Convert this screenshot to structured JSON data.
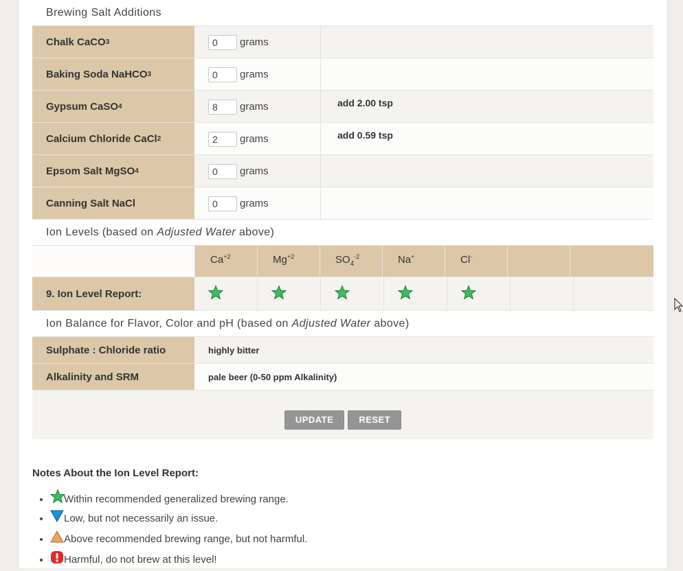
{
  "salts": {
    "title": "Brewing Salt Additions",
    "unit": "grams",
    "rows": [
      {
        "name": "Chalk CaCO",
        "sub": "3",
        "value": "0",
        "note": ""
      },
      {
        "name": "Baking Soda NaHCO",
        "sub": "3",
        "value": "0",
        "note": ""
      },
      {
        "name": "Gypsum CaSO",
        "sub": "4",
        "value": "8",
        "note": "add 2.00 tsp"
      },
      {
        "name": "Calcium Chloride CaCl",
        "sub": "2",
        "value": "2",
        "note": "add 0.59 tsp"
      },
      {
        "name": "Epsom Salt MgSO",
        "sub": "4",
        "value": "0",
        "note": ""
      },
      {
        "name": "Canning Salt NaCl",
        "sub": "",
        "value": "0",
        "note": ""
      }
    ]
  },
  "ions": {
    "title_pre": "Ion Levels (based on ",
    "title_em": "Adjusted Water",
    "title_post": " above)",
    "headers": [
      {
        "base": "Ca",
        "sup": "+2",
        "sub": ""
      },
      {
        "base": "Mg",
        "sup": "+2",
        "sub": ""
      },
      {
        "base": "SO",
        "sub": "4",
        "sup": "-2"
      },
      {
        "base": "Na",
        "sup": "+",
        "sub": ""
      },
      {
        "base": "Cl",
        "sup": "-",
        "sub": ""
      }
    ],
    "report_label": "9. Ion Level Report:",
    "report_icons": [
      "star-icon",
      "star-icon",
      "star-icon",
      "star-icon",
      "star-icon"
    ],
    "star_color": "#3dbb5e"
  },
  "balance": {
    "title_pre": "Ion Balance for Flavor, Color and pH (based on ",
    "title_em": "Adjusted Water",
    "title_post": " above)",
    "rows": [
      {
        "label": "Sulphate : Chloride ratio",
        "value": "highly bitter"
      },
      {
        "label": "Alkalinity and SRM",
        "value": "pale beer (0-50 ppm Alkalinity)"
      }
    ]
  },
  "buttons": {
    "update": "UPDATE",
    "reset": "RESET"
  },
  "notes": {
    "title": "Notes About the Ion Level Report:",
    "items": [
      {
        "icon": "green-star-icon",
        "color": "#3dbb5e",
        "text": "Within recommended generalized brewing range."
      },
      {
        "icon": "blue-down-triangle-icon",
        "color": "#1a8fe0",
        "text": "Low, but not necessarily an issue."
      },
      {
        "icon": "orange-up-triangle-icon",
        "color": "#f0a060",
        "text": "Above recommended brewing range, but not harmful."
      },
      {
        "icon": "red-exclamation-icon",
        "color": "#e02a2a",
        "text": "Harmful, do not brew at this level!"
      }
    ]
  }
}
